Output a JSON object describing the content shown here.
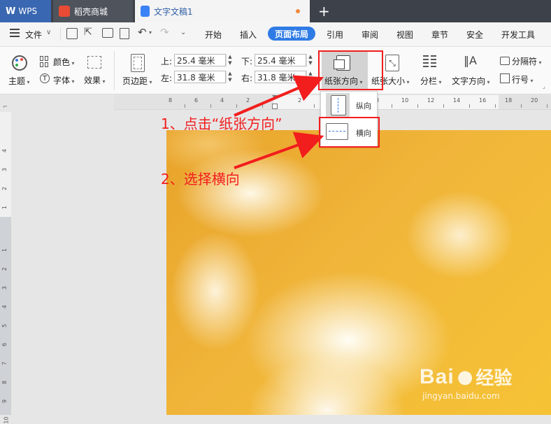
{
  "tabs": [
    {
      "label": "WPS"
    },
    {
      "label": "稻壳商城"
    },
    {
      "label": "文字文稿1"
    }
  ],
  "menu": {
    "file": "文件",
    "items": [
      "开始",
      "插入",
      "页面布局",
      "引用",
      "审阅",
      "视图",
      "章节",
      "安全",
      "开发工具"
    ]
  },
  "ribbon": {
    "theme": "主题",
    "color": "颜色",
    "font": "字体",
    "effect": "效果",
    "margins": "页边距",
    "top_label": "上:",
    "top_value": "25.4 毫米",
    "bottom_label": "下:",
    "bottom_value": "25.4 毫米",
    "left_label": "左:",
    "left_value": "31.8 毫米",
    "right_label": "右:",
    "right_value": "31.8 毫米",
    "orientation": "纸张方向",
    "paper_size": "纸张大小",
    "columns": "分栏",
    "text_direction": "文字方向",
    "separator": "分隔符",
    "line_numbers": "行号"
  },
  "dropdown": {
    "portrait": "纵向",
    "landscape": "横向"
  },
  "ruler": {
    "h_ticks": [
      "8",
      "6",
      "4",
      "2",
      "2",
      "4",
      "6",
      "8",
      "10",
      "12",
      "14",
      "16",
      "18",
      "20",
      "22"
    ],
    "v_ticks": [
      "4",
      "3",
      "2",
      "1",
      "1",
      "2",
      "3",
      "4",
      "5",
      "6",
      "7",
      "8",
      "9",
      "10"
    ]
  },
  "annotations": {
    "step1": "1、点击“纸张方向”",
    "step2": "2、选择横向"
  },
  "watermark": {
    "brand": "Bai",
    "brand2": "经验",
    "url": "jingyan.baidu.com"
  },
  "colors": {
    "accent": "#2f7be5",
    "annotation": "#f21d1d",
    "tabbar": "#3d4149"
  }
}
